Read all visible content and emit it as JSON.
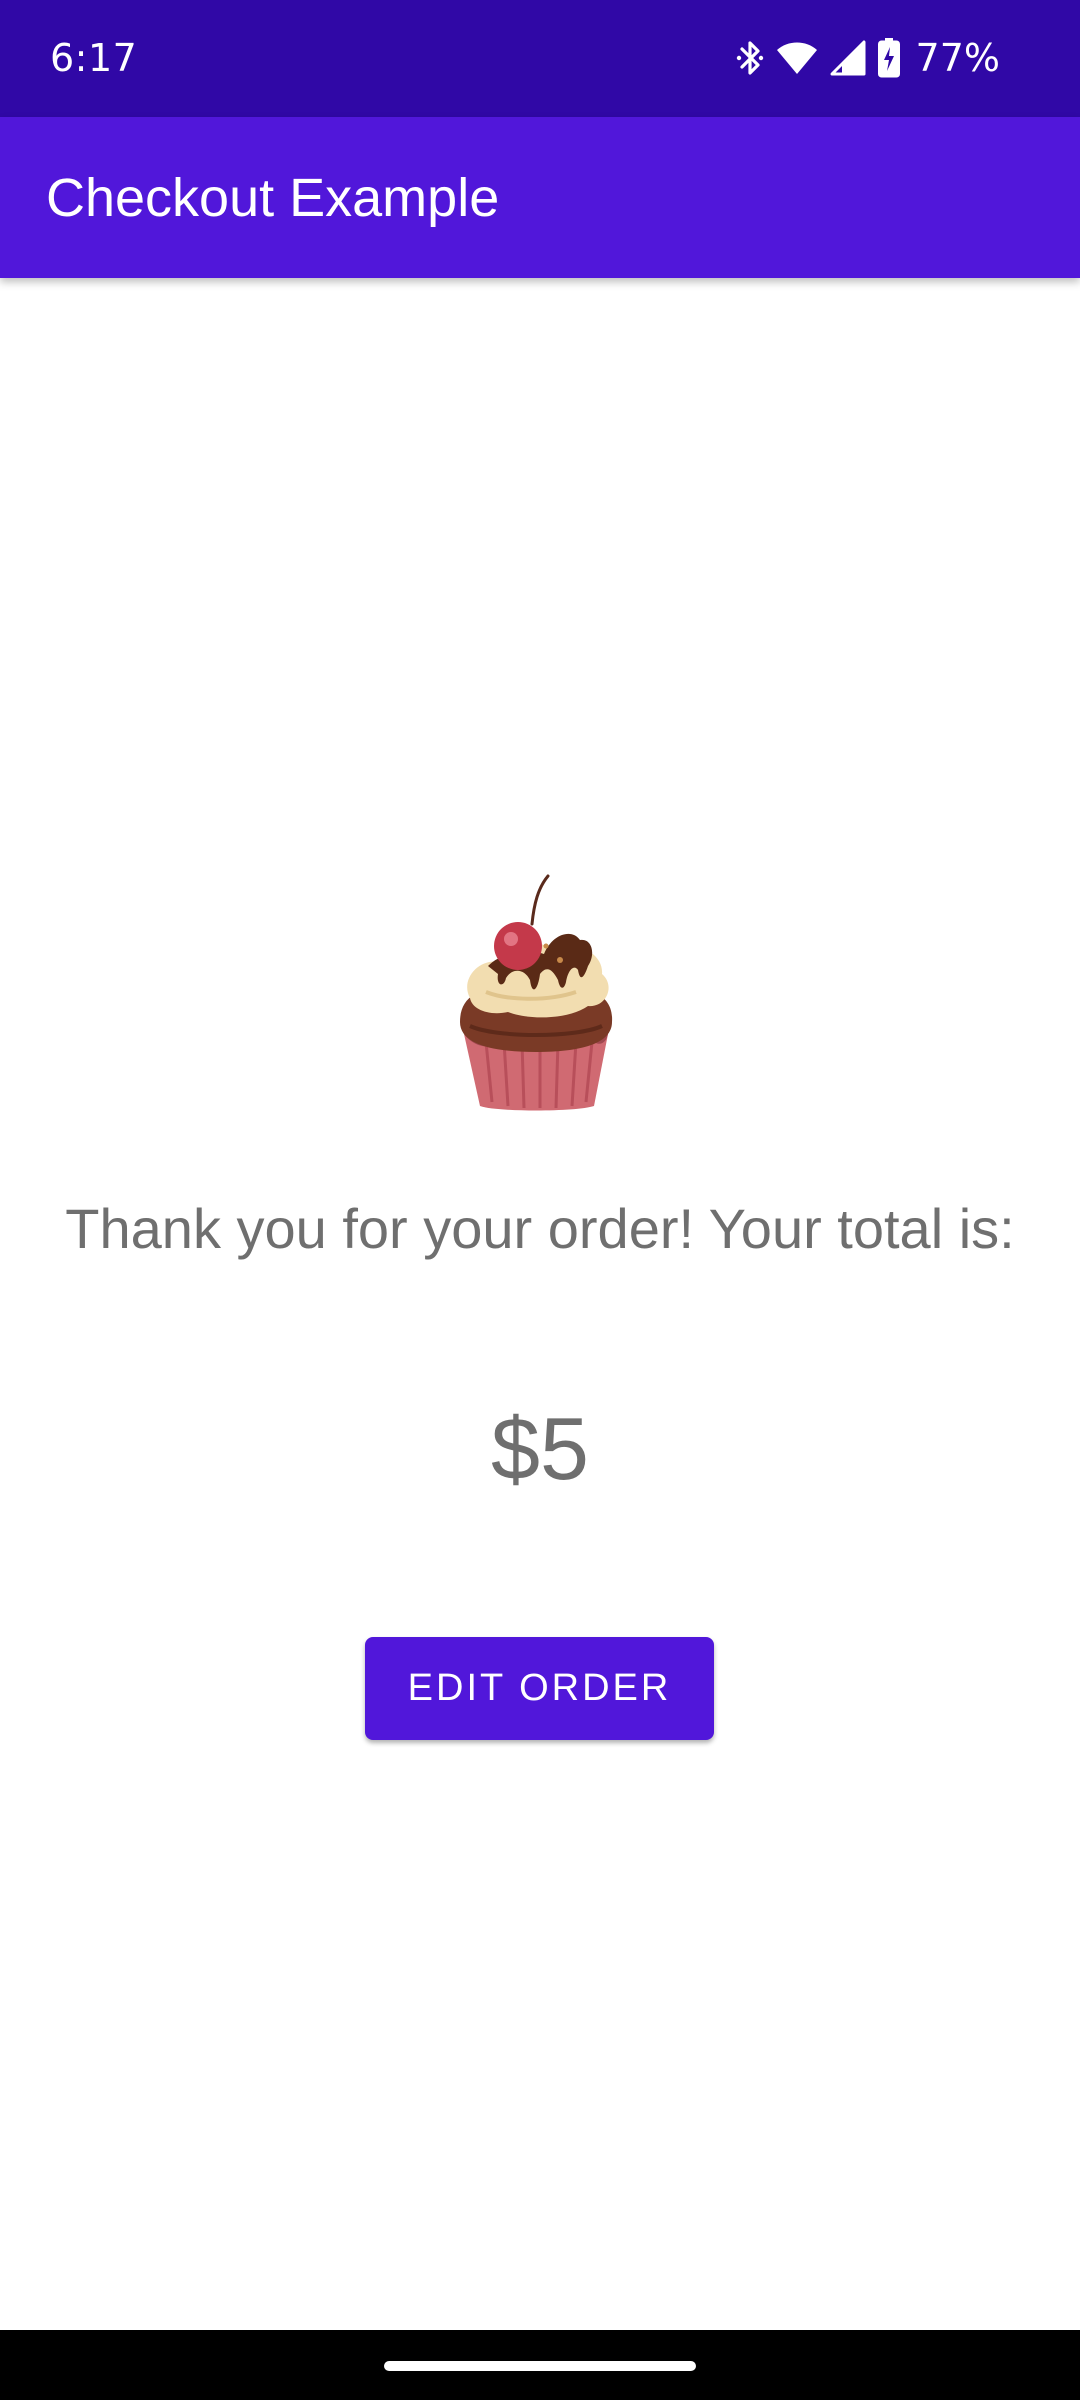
{
  "status_bar": {
    "time": "6:17",
    "battery_percent": "77%",
    "icons": [
      "bluetooth-icon",
      "wifi-icon",
      "cell-signal-icon",
      "battery-charging-icon"
    ],
    "background": "#3008A6"
  },
  "app_bar": {
    "title": "Checkout Example",
    "background": "#5117DA"
  },
  "main": {
    "image_name": "cupcake-image",
    "thanks_message": "Thank you for your order! Your total is:",
    "total": "$5",
    "edit_button_label": "EDIT ORDER"
  },
  "colors": {
    "primary": "#5117DA",
    "text_secondary": "#6f6f6f"
  }
}
